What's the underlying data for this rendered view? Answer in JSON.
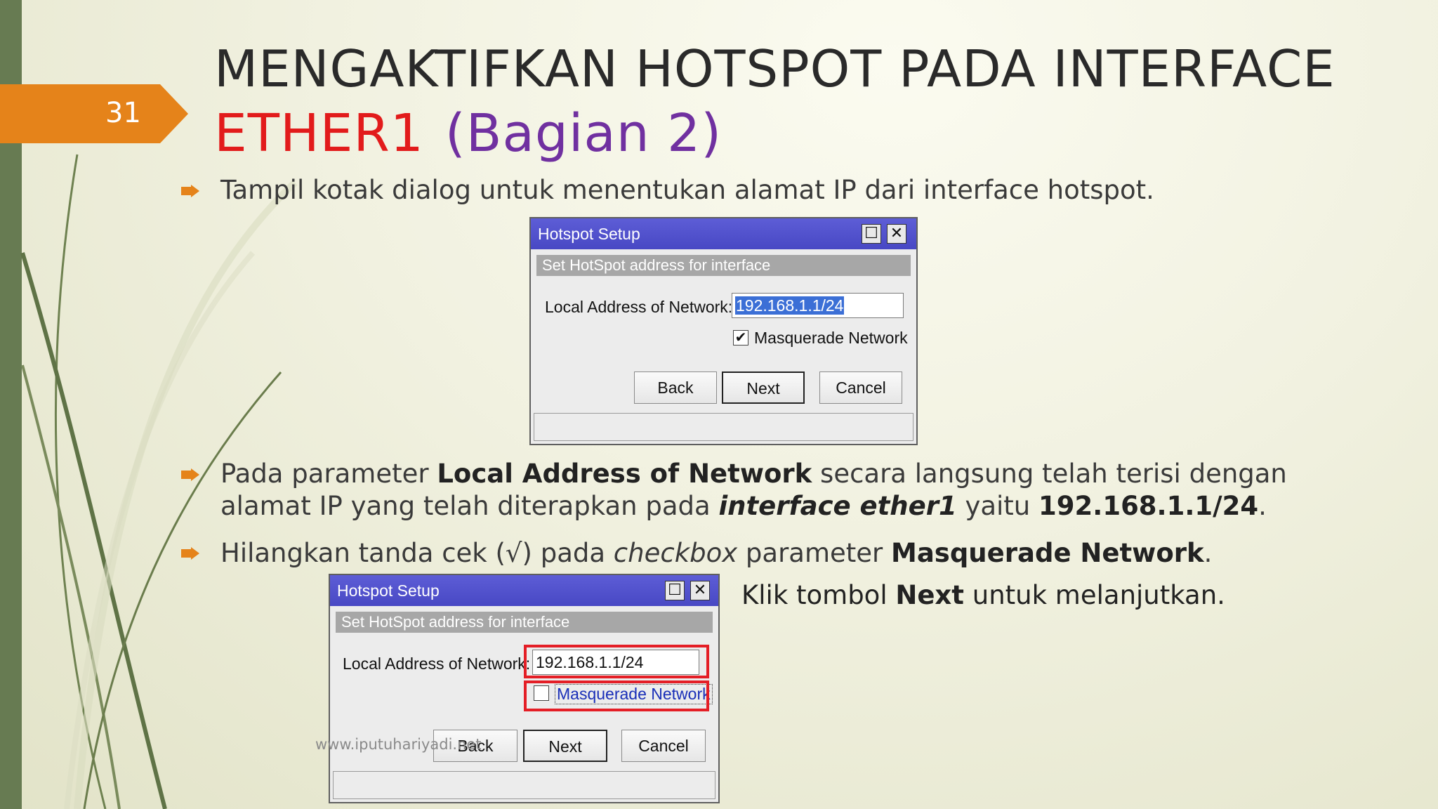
{
  "slide": {
    "number": "31",
    "title_line1": "MENGAKTIFKAN HOTSPOT PADA INTERFACE",
    "title_red": "ETHER1",
    "title_purple": "(Bagian 2)"
  },
  "bullets": {
    "b1": "Tampil kotak dialog untuk menentukan alamat IP dari interface hotspot.",
    "b2_a": "Pada parameter ",
    "b2_b": "Local Address of Network",
    "b2_c": " secara langsung telah terisi dengan",
    "b2_d": "alamat IP yang telah diterapkan pada ",
    "b2_e": "interface ether1",
    "b2_f": " yaitu ",
    "b2_g": "192.168.1.1/24",
    "b2_h": ".",
    "b3_a": "Hilangkan tanda cek (√) pada ",
    "b3_b": "checkbox",
    "b3_c": " parameter ",
    "b3_d": "Masquerade Network",
    "b3_e": ".",
    "note_a": "Klik tombol ",
    "note_b": "Next",
    "note_c": " untuk melanjutkan."
  },
  "dialog1": {
    "title": "Hotspot Setup",
    "subheader": "Set HotSpot address for interface",
    "field_label": "Local Address of Network:",
    "field_value": "192.168.1.1/24",
    "checkbox_label": "Masquerade Network",
    "checkbox_checked": true,
    "check_mark": "✔",
    "back_label": "Back",
    "next_label": "Next",
    "cancel_label": "Cancel",
    "maximize_glyph": "☐",
    "close_glyph": "✕"
  },
  "dialog2": {
    "title": "Hotspot Setup",
    "subheader": "Set HotSpot address for interface",
    "field_label": "Local Address of Network:",
    "field_value": "192.168.1.1/24",
    "checkbox_label": "Masquerade Network",
    "checkbox_checked": false,
    "back_label": "Back",
    "next_label": "Next",
    "cancel_label": "Cancel",
    "maximize_glyph": "☐",
    "close_glyph": "✕"
  },
  "footer": "www.iputuhariyadi.net",
  "colors": {
    "accent_orange": "#e5831a",
    "title_red": "#e21b1b",
    "title_purple": "#7030a0",
    "highlight": "#e41e26"
  }
}
